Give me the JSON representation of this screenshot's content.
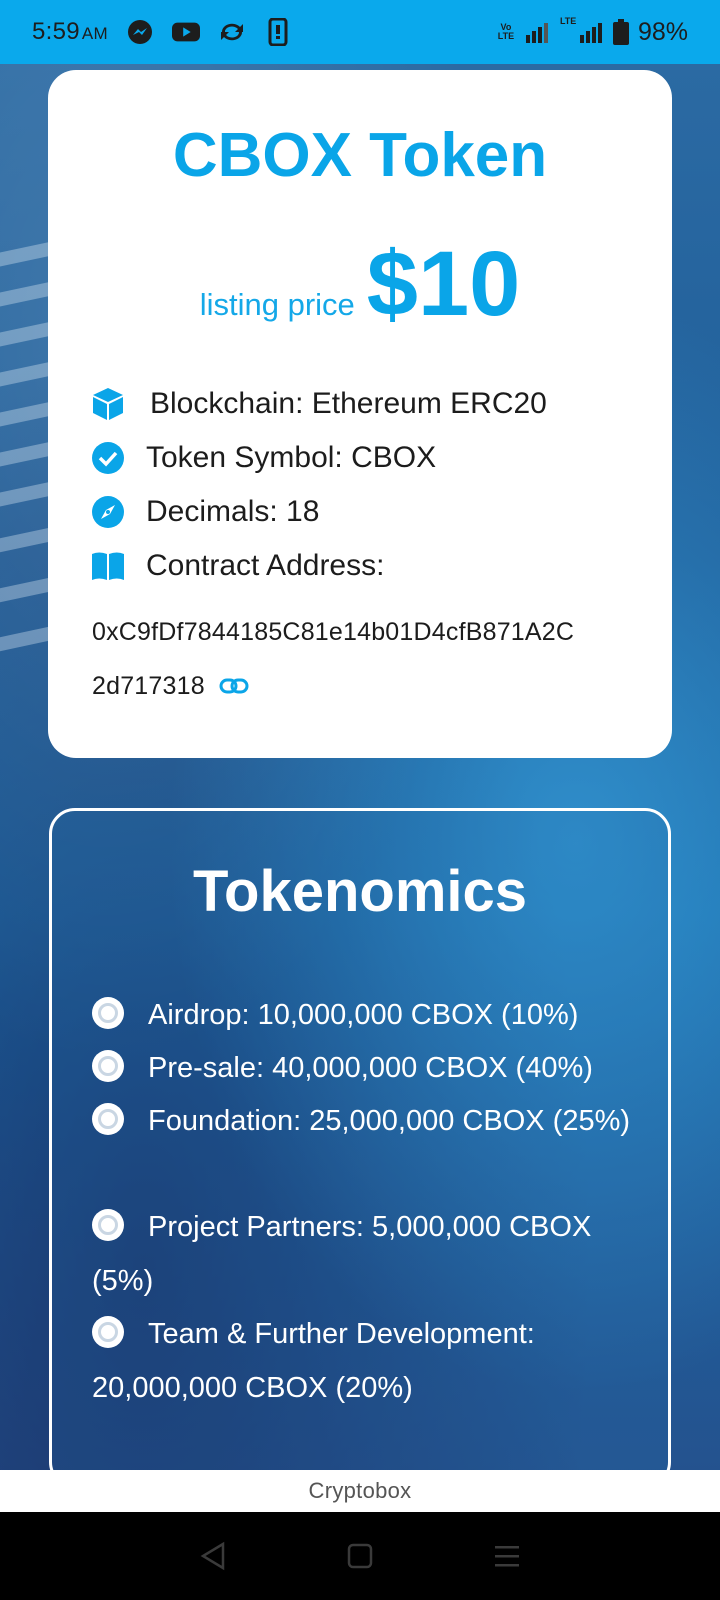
{
  "status_bar": {
    "time": "5:59",
    "ampm": "AM",
    "battery": "98%",
    "network_label": "LTE",
    "volte_label": "Vo LTE",
    "icons": [
      "messenger-icon",
      "youtube-icon",
      "sync-icon",
      "phone-icon",
      "volte-icon",
      "signal-icon",
      "lte-signal-icon",
      "battery-icon"
    ]
  },
  "token_card": {
    "title": "CBOX Token",
    "price_label": "listing price",
    "price_value": "$10",
    "items": [
      {
        "icon": "cube-icon",
        "label": "Blockchain: Ethereum ERC20"
      },
      {
        "icon": "check-circle-icon",
        "label": "Token Symbol: CBOX"
      },
      {
        "icon": "compass-icon",
        "label": "Decimals: 18"
      },
      {
        "icon": "book-icon",
        "label": "Contract Address:"
      }
    ],
    "address_line1": "0xC9fDf7844185C81e14b01D4cfB871A2C",
    "address_line2": "2d717318",
    "accent": "#0aa5e8"
  },
  "tokenomics": {
    "title": "Tokenomics",
    "items": [
      "Airdrop: 10,000,000 CBOX (10%)",
      "Pre-sale: 40,000,000 CBOX (40%)",
      "Foundation: 25,000,000 CBOX (25%)",
      "Project Partners: 5,000,000 CBOX (5%)",
      "Team & Further Development: 20,000,000 CBOX (20%)"
    ]
  },
  "browser": {
    "site_name": "Cryptobox"
  },
  "colors": {
    "status_bar": "#0aa9ec",
    "accent": "#0aa5e8"
  }
}
